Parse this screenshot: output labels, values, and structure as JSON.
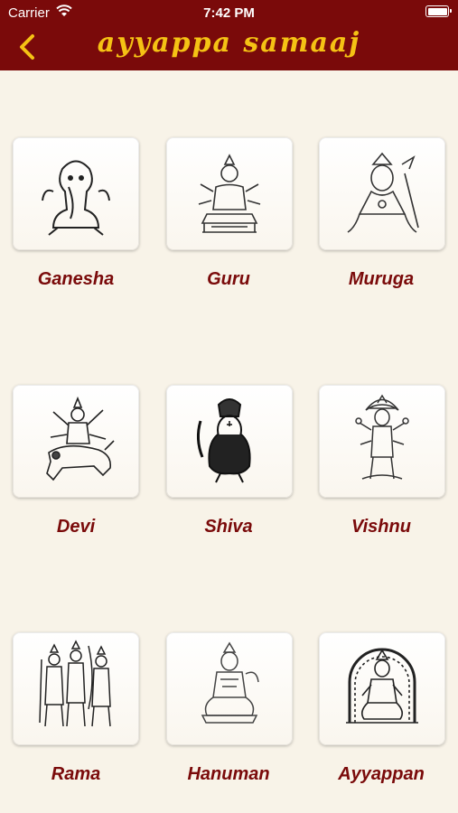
{
  "status_bar": {
    "carrier": "Carrier",
    "time": "7:42 PM"
  },
  "header": {
    "title": "ayyappa samaaj",
    "back_icon": "chevron-left-icon"
  },
  "colors": {
    "header_bg": "#7a0a0a",
    "title": "#f5c214",
    "label": "#7a0a0a",
    "background": "#f8f3e8"
  },
  "deities": [
    {
      "name": "Ganesha",
      "icon": "ganesha-icon"
    },
    {
      "name": "Guru",
      "icon": "guru-icon"
    },
    {
      "name": "Muruga",
      "icon": "muruga-icon"
    },
    {
      "name": "Devi",
      "icon": "devi-icon"
    },
    {
      "name": "Shiva",
      "icon": "shiva-icon"
    },
    {
      "name": "Vishnu",
      "icon": "vishnu-icon"
    },
    {
      "name": "Rama",
      "icon": "rama-icon"
    },
    {
      "name": "Hanuman",
      "icon": "hanuman-icon"
    },
    {
      "name": "Ayyappan",
      "icon": "ayyappan-icon"
    }
  ]
}
